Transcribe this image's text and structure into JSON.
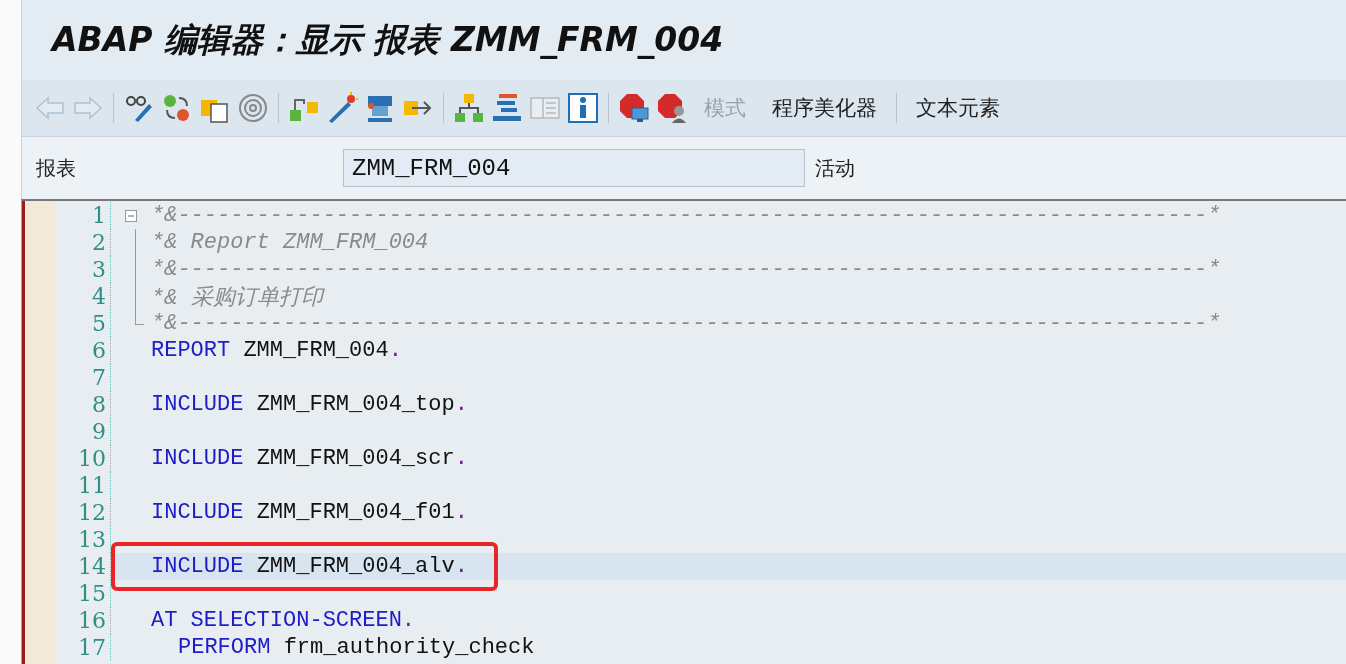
{
  "window": {
    "title": "ABAP 编辑器：显示 报表 ZMM_FRM_004"
  },
  "toolbar": {
    "icons": [
      {
        "kind": "back",
        "disabled": true
      },
      {
        "kind": "forward",
        "disabled": true
      },
      {
        "kind": "sep"
      },
      {
        "kind": "glasses-pencil",
        "disabled": false
      },
      {
        "kind": "swap",
        "disabled": false
      },
      {
        "kind": "copy",
        "disabled": false
      },
      {
        "kind": "spiral",
        "disabled": false
      },
      {
        "kind": "sep"
      },
      {
        "kind": "hierarchy",
        "disabled": false
      },
      {
        "kind": "wand",
        "disabled": false
      },
      {
        "kind": "clamp",
        "disabled": false
      },
      {
        "kind": "export",
        "disabled": false
      },
      {
        "kind": "sep"
      },
      {
        "kind": "tree",
        "disabled": false
      },
      {
        "kind": "stack",
        "disabled": false
      },
      {
        "kind": "list",
        "disabled": true
      },
      {
        "kind": "info",
        "disabled": false
      },
      {
        "kind": "sep"
      },
      {
        "kind": "stop-monitor",
        "disabled": false
      },
      {
        "kind": "stop-person",
        "disabled": false
      }
    ],
    "buttons": [
      {
        "label": "模式",
        "disabled": true
      },
      {
        "label": "程序美化器",
        "disabled": false
      },
      {
        "label": "文本元素",
        "disabled": false
      }
    ]
  },
  "header": {
    "label": "报表",
    "value": "ZMM_FRM_004",
    "status": "活动"
  },
  "editor": {
    "lines": [
      {
        "number": "1",
        "kind": "fold-start",
        "current": false,
        "tokens": [
          {
            "text": "*&------------------------------------------------------------------------------*",
            "kind": "comment"
          }
        ]
      },
      {
        "number": "2",
        "kind": "fold-inner",
        "current": false,
        "tokens": [
          {
            "text": "*& Report ZMM_FRM_004",
            "kind": "comment"
          }
        ]
      },
      {
        "number": "3",
        "kind": "fold-inner",
        "current": false,
        "tokens": [
          {
            "text": "*&------------------------------------------------------------------------------*",
            "kind": "comment"
          }
        ]
      },
      {
        "number": "4",
        "kind": "fold-inner",
        "current": false,
        "tokens": [
          {
            "text": "*& 采购订单打印",
            "kind": "comment"
          }
        ]
      },
      {
        "number": "5",
        "kind": "fold-end",
        "current": false,
        "tokens": [
          {
            "text": "*&------------------------------------------------------------------------------*",
            "kind": "comment"
          }
        ]
      },
      {
        "number": "6",
        "current": false,
        "tokens": [
          {
            "text": "REPORT",
            "kind": "keyword"
          },
          {
            "text": "ZMM_FRM_004",
            "kind": "name"
          },
          {
            "text": ".",
            "kind": "dot"
          }
        ]
      },
      {
        "number": "7",
        "current": false
      },
      {
        "number": "8",
        "current": false,
        "tokens": [
          {
            "text": "INCLUDE",
            "kind": "keyword"
          },
          {
            "text": "ZMM_FRM_004_top",
            "kind": "name"
          },
          {
            "text": ".",
            "kind": "dot"
          }
        ]
      },
      {
        "number": "9",
        "current": false
      },
      {
        "number": "10",
        "current": false,
        "tokens": [
          {
            "text": "INCLUDE",
            "kind": "keyword"
          },
          {
            "text": "ZMM_FRM_004_scr",
            "kind": "name"
          },
          {
            "text": ".",
            "kind": "dot"
          }
        ]
      },
      {
        "number": "11",
        "current": false
      },
      {
        "number": "12",
        "current": false,
        "tokens": [
          {
            "text": "INCLUDE",
            "kind": "keyword"
          },
          {
            "text": "ZMM_FRM_004_f01",
            "kind": "name"
          },
          {
            "text": ".",
            "kind": "dot"
          }
        ]
      },
      {
        "number": "13",
        "current": false
      },
      {
        "number": "14",
        "current": true,
        "marked": true,
        "tokens": [
          {
            "text": "INCLUDE",
            "kind": "keyword"
          },
          {
            "text": "ZMM_FRM_004_alv",
            "kind": "name"
          },
          {
            "text": ".",
            "kind": "dot"
          }
        ]
      },
      {
        "number": "15",
        "current": false
      },
      {
        "number": "16",
        "current": false,
        "tokens": [
          {
            "text": "AT SELECTION-SCREEN",
            "kind": "keyword"
          },
          {
            "text": ".",
            "kind": "dot"
          }
        ]
      },
      {
        "number": "17",
        "current": false,
        "indent": true,
        "tokens": [
          {
            "text": "PERFORM",
            "kind": "keyword"
          },
          {
            "text": "frm_authority_check",
            "kind": "name"
          }
        ]
      }
    ]
  }
}
